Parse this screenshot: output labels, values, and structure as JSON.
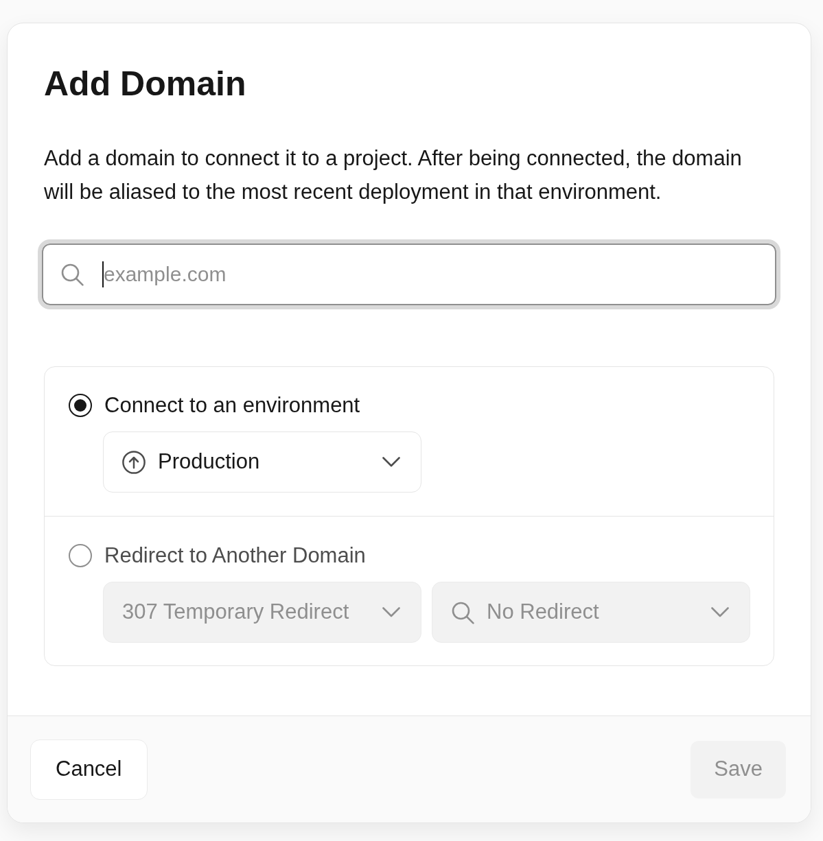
{
  "dialog": {
    "title": "Add Domain",
    "description": "Add a domain to connect it to a project. After being connected, the domain will be aliased to the most recent deployment in that environment.",
    "domain_field": {
      "placeholder": "example.com",
      "focused": true
    },
    "options": [
      {
        "label": "Connect to an environment",
        "selected": true,
        "selects": [
          {
            "kind": "environment",
            "value": "Production",
            "disabled": false
          }
        ]
      },
      {
        "label": "Redirect to Another Domain",
        "selected": false,
        "selects": [
          {
            "kind": "status",
            "value": "307 Temporary Redirect",
            "disabled": true
          },
          {
            "kind": "search",
            "value": "No Redirect",
            "disabled": true
          }
        ]
      }
    ],
    "buttons": [
      {
        "kind": "secondary",
        "label": "Cancel",
        "disabled": false
      },
      {
        "kind": "primary",
        "label": "Save",
        "disabled": true
      }
    ]
  }
}
